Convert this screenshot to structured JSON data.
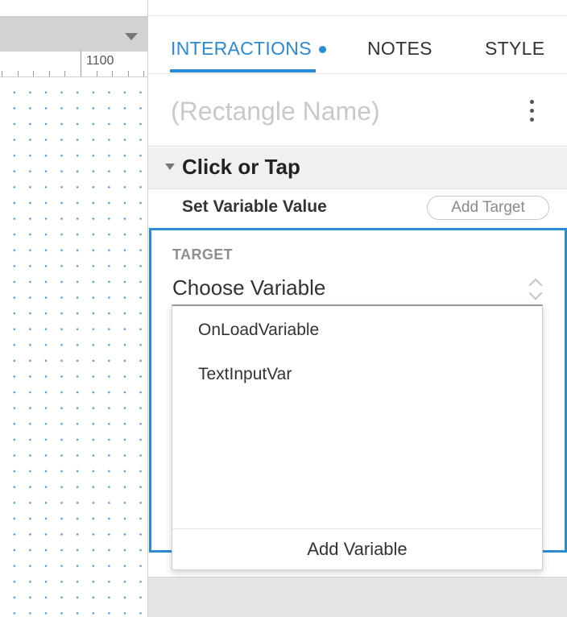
{
  "canvas": {
    "ruler_label": "1100",
    "grid_dot_color": "#5b9bd5"
  },
  "tabs": [
    {
      "label": "INTERACTIONS",
      "active": true,
      "has_indicator": true
    },
    {
      "label": "NOTES",
      "active": false
    },
    {
      "label": "STYLE",
      "active": false
    }
  ],
  "colors": {
    "accent": "#2a8bd6"
  },
  "widget": {
    "name_placeholder": "(Rectangle Name)"
  },
  "event": {
    "title": "Click or Tap",
    "action": {
      "title": "Set Variable Value",
      "add_target_label": "Add Target"
    }
  },
  "target": {
    "label": "TARGET",
    "select_value": "Choose Variable"
  },
  "dropdown": {
    "options": [
      "OnLoadVariable",
      "TextInputVar"
    ],
    "footer_label": "Add Variable"
  },
  "icons": {
    "more": "kebab-menu-icon",
    "collapse": "caret-down-icon",
    "select": "up-down-chevron-icon",
    "canvas_dropdown": "triangle-down-icon"
  }
}
